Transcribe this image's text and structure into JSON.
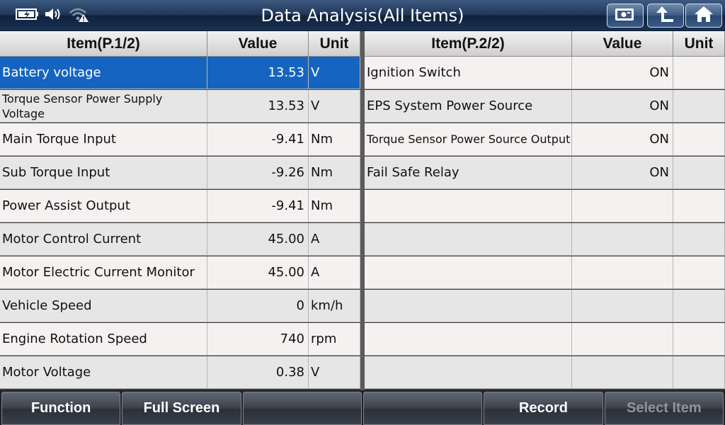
{
  "header": {
    "title": "Data Analysis(All Items)",
    "status_icons": [
      "battery-charging-icon",
      "speaker-icon",
      "wifi-warning-icon"
    ],
    "buttons": [
      "screenshot-icon",
      "back-up-icon",
      "home-icon"
    ]
  },
  "left_table": {
    "col_item": "Item(P.1/2)",
    "col_value": "Value",
    "col_unit": "Unit",
    "rows": [
      {
        "item": "Battery voltage",
        "value": "13.53",
        "unit": "V",
        "selected": true
      },
      {
        "item": "Torque Sensor Power Supply Voltage",
        "value": "13.53",
        "unit": "V"
      },
      {
        "item": "Main Torque Input",
        "value": "-9.41",
        "unit": "Nm"
      },
      {
        "item": "Sub Torque Input",
        "value": "-9.26",
        "unit": "Nm"
      },
      {
        "item": "Power Assist Output",
        "value": "-9.41",
        "unit": "Nm"
      },
      {
        "item": "Motor Control Current",
        "value": "45.00",
        "unit": "A"
      },
      {
        "item": "Motor Electric Current Monitor",
        "value": "45.00",
        "unit": "A"
      },
      {
        "item": "Vehicle Speed",
        "value": "0",
        "unit": "km/h"
      },
      {
        "item": "Engine Rotation Speed",
        "value": "740",
        "unit": "rpm"
      },
      {
        "item": "Motor Voltage",
        "value": "0.38",
        "unit": "V"
      }
    ]
  },
  "right_table": {
    "col_item": "Item(P.2/2)",
    "col_value": "Value",
    "col_unit": "Unit",
    "rows": [
      {
        "item": "Ignition Switch",
        "value": "ON",
        "unit": ""
      },
      {
        "item": "EPS System Power Source",
        "value": "ON",
        "unit": ""
      },
      {
        "item": "Torque Sensor Power Source Output",
        "value": "ON",
        "unit": ""
      },
      {
        "item": "Fail Safe Relay",
        "value": "ON",
        "unit": ""
      },
      {
        "item": "",
        "value": "",
        "unit": ""
      },
      {
        "item": "",
        "value": "",
        "unit": ""
      },
      {
        "item": "",
        "value": "",
        "unit": ""
      },
      {
        "item": "",
        "value": "",
        "unit": ""
      },
      {
        "item": "",
        "value": "",
        "unit": ""
      },
      {
        "item": "",
        "value": "",
        "unit": ""
      }
    ]
  },
  "bottom_bar": {
    "buttons": [
      {
        "label": "Function",
        "enabled": true
      },
      {
        "label": "Full Screen",
        "enabled": true
      },
      {
        "label": "",
        "enabled": true
      },
      {
        "label": "",
        "enabled": true
      },
      {
        "label": "Record",
        "enabled": true
      },
      {
        "label": "Select Item",
        "enabled": false
      }
    ]
  },
  "colors": {
    "selected_row": "#1565c0",
    "title_bar": "#1f3658"
  }
}
